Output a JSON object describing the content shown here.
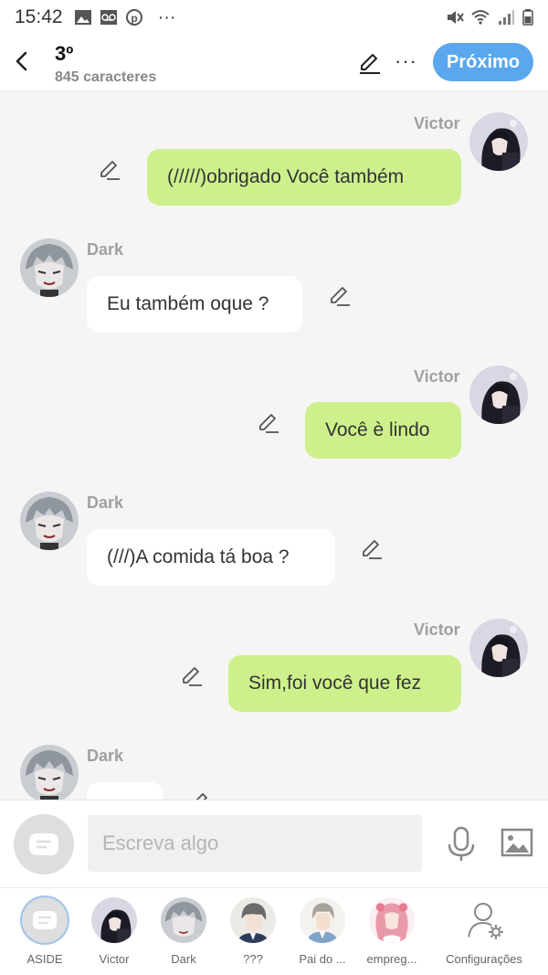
{
  "status_bar": {
    "time": "15:42",
    "left_icons": [
      "image-icon",
      "voicemail-icon",
      "pinterest-icon",
      "more-dots-icon"
    ],
    "right_icons": [
      "mute-icon",
      "wifi-icon",
      "signal-icon",
      "battery-icon"
    ]
  },
  "header": {
    "title": "3º",
    "subtitle": "845 caracteres",
    "next_label": "Próximo",
    "more_label": "···",
    "accent": "#5aa7ee"
  },
  "messages": [
    {
      "side": "right",
      "sender": "Victor",
      "text": "(/////)obrigado Você também",
      "avatar": "victor"
    },
    {
      "side": "left",
      "sender": "Dark",
      "text": "Eu também oque ?",
      "avatar": "dark"
    },
    {
      "side": "right",
      "sender": "Victor",
      "text": "Você è lindo",
      "avatar": "victor"
    },
    {
      "side": "left",
      "sender": "Dark",
      "text": "(///)A comida tá boa ?",
      "avatar": "dark"
    },
    {
      "side": "right",
      "sender": "Victor",
      "text": "Sim,foi você que fez",
      "avatar": "victor"
    },
    {
      "side": "left",
      "sender": "Dark",
      "text": "",
      "avatar": "dark"
    }
  ],
  "composer": {
    "placeholder": "Escreva algo"
  },
  "tabs": [
    {
      "label": "ASIDE",
      "kind": "chat-icon"
    },
    {
      "label": "Victor",
      "kind": "victor"
    },
    {
      "label": "Dark",
      "kind": "dark"
    },
    {
      "label": "???",
      "kind": "mystery"
    },
    {
      "label": "Pai do ...",
      "kind": "father"
    },
    {
      "label": "empreg...",
      "kind": "maid"
    },
    {
      "label": "Configurações",
      "kind": "settings-icon"
    }
  ],
  "colors": {
    "bubble_right": "#cdf08c",
    "bubble_left": "#ffffff",
    "background": "#f5f5f5"
  }
}
